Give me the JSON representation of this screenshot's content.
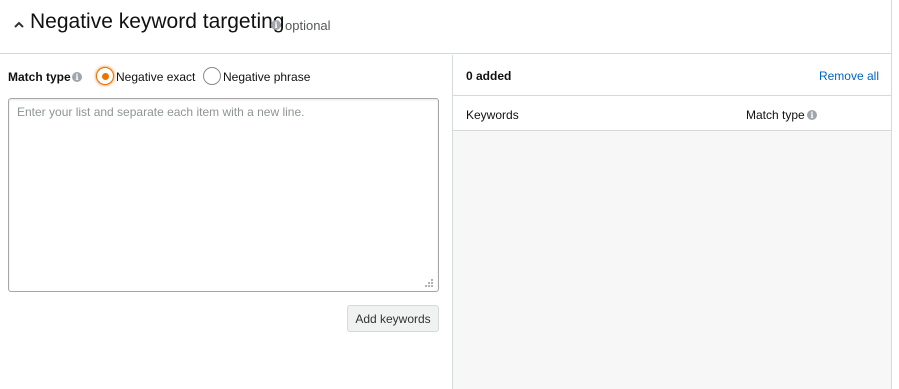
{
  "header": {
    "title": "Negative keyword targeting",
    "optional_label": "optional",
    "collapse_icon": "chevron-up-icon",
    "info_icon": "info-icon"
  },
  "match_type": {
    "label": "Match type",
    "options": [
      {
        "label": "Negative exact",
        "selected": true
      },
      {
        "label": "Negative phrase",
        "selected": false
      }
    ]
  },
  "keyword_input": {
    "placeholder": "Enter your list and separate each item with a new line.",
    "value": ""
  },
  "add_button": {
    "label": "Add keywords"
  },
  "added_panel": {
    "count_label": "0 added",
    "remove_all_label": "Remove all",
    "columns": [
      "Keywords",
      "Match type"
    ]
  },
  "colors": {
    "accent": "#e77600",
    "link": "#0066c0",
    "border": "#d5d9d9",
    "panel_bg": "#f7f7f7"
  }
}
